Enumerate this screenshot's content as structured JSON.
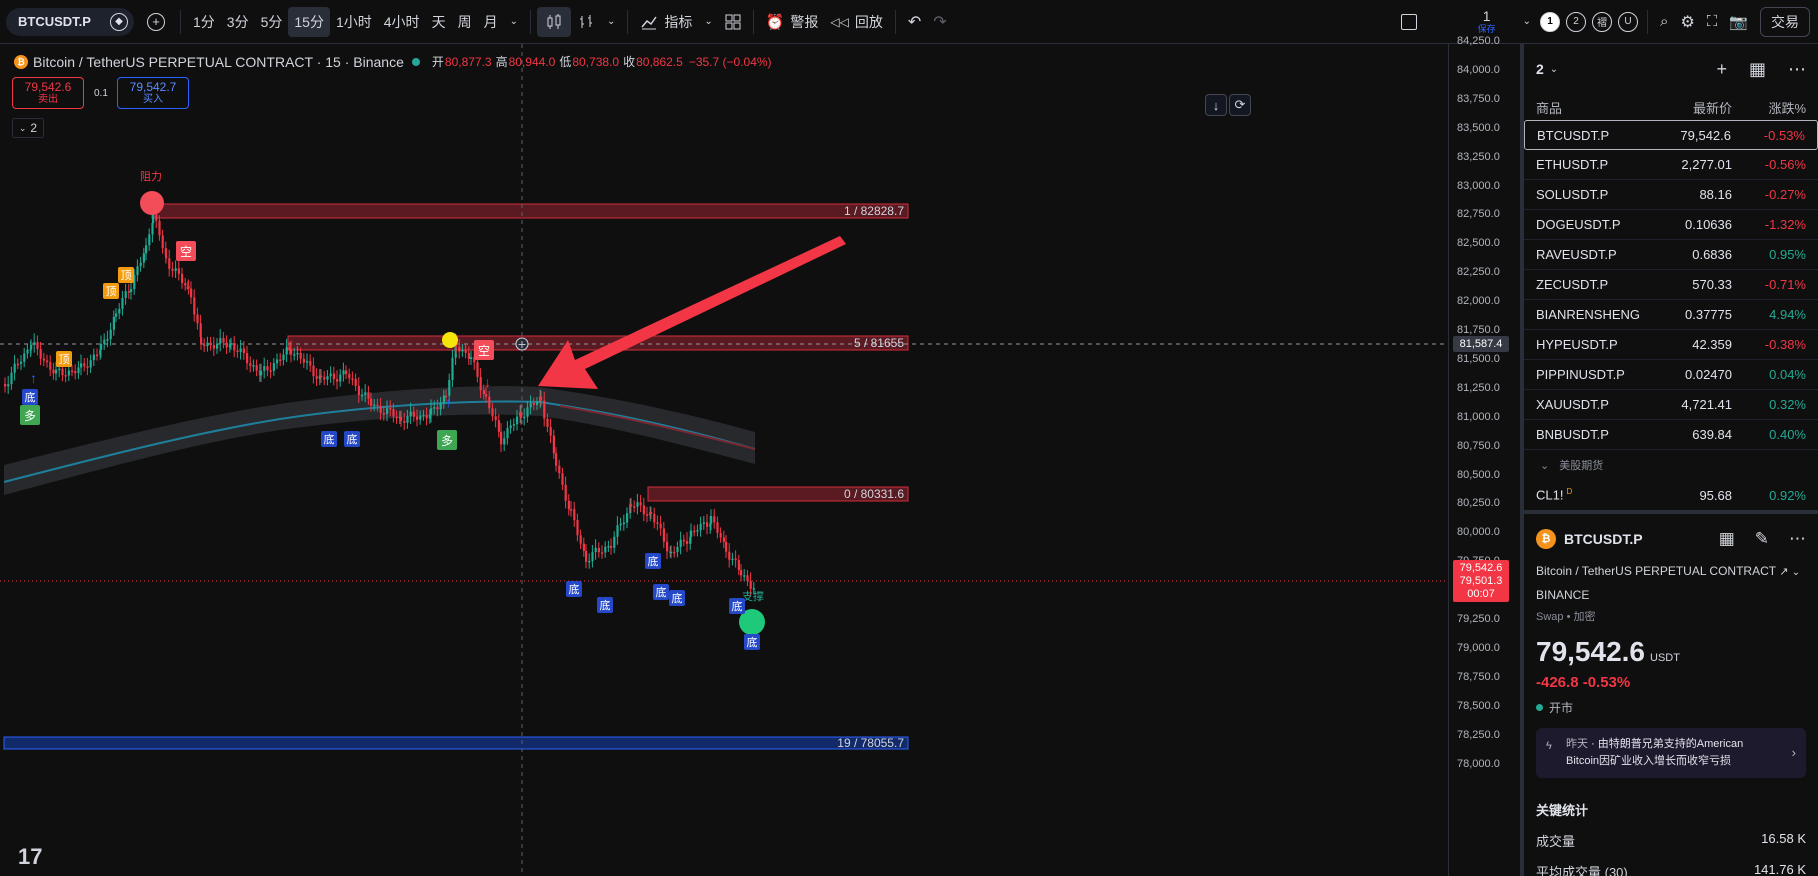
{
  "toolbar": {
    "symbol": "BTCUSDT.P",
    "timeframes": [
      "1分",
      "3分",
      "5分",
      "15分",
      "1小时",
      "4小时",
      "天",
      "周",
      "月"
    ],
    "active_timeframe": "15分",
    "indicators_label": "指标",
    "alert_label": "警报",
    "replay_label": "回放",
    "save_count": "1",
    "save_label": "保存",
    "layout_buttons": [
      "1",
      "2",
      "褶",
      "U"
    ],
    "trade_label": "交易"
  },
  "legend": {
    "title": "Bitcoin / TetherUS PERPETUAL CONTRACT · 15 · Binance",
    "open_label": "开",
    "open": "80,877.3",
    "high_label": "高",
    "high": "80,944.0",
    "low_label": "低",
    "low": "80,738.0",
    "close_label": "收",
    "close": "80,862.5",
    "change": "−35.7 (−0.04%)"
  },
  "order": {
    "sell_price": "79,542.6",
    "sell_label": "卖出",
    "spread": "0.1",
    "buy_price": "79,542.7",
    "buy_label": "买入",
    "collapse_count": "2"
  },
  "price_scale": {
    "ticks": [
      "84,250.0",
      "84,000.0",
      "83,750.0",
      "83,500.0",
      "83,250.0",
      "83,000.0",
      "82,750.0",
      "82,500.0",
      "82,250.0",
      "82,000.0",
      "81,750.0",
      "81,500.0",
      "81,250.0",
      "81,000.0",
      "80,750.0",
      "80,500.0",
      "80,250.0",
      "80,000.0",
      "79,750.0",
      "79,500.0",
      "79,250.0",
      "79,000.0",
      "78,750.0",
      "78,500.0",
      "78,250.0",
      "78,000.0"
    ],
    "crosshair_price": "81,587.4",
    "last_price": "79,542.6",
    "last_price2": "79,501.3",
    "countdown": "00:07"
  },
  "chart_annotations": {
    "resistance_label": "阻力",
    "levels": [
      "1 / 82828.7",
      "5 / 81655",
      "0 / 80331.6",
      "19 / 78055.7"
    ],
    "support_label": "支撑",
    "top": "顶",
    "bottom": "底",
    "long": "多",
    "short": "空"
  },
  "watchlist": {
    "id": "2",
    "columns": [
      "商品",
      "最新价",
      "涨跌%"
    ],
    "rows": [
      {
        "symbol": "BTCUSDT.P",
        "price": "79,542.6",
        "change": "-0.53%",
        "dir": "dn"
      },
      {
        "symbol": "ETHUSDT.P",
        "price": "2,277.01",
        "change": "-0.56%",
        "dir": "dn"
      },
      {
        "symbol": "SOLUSDT.P",
        "price": "88.16",
        "change": "-0.27%",
        "dir": "dn"
      },
      {
        "symbol": "DOGEUSDT.P",
        "price": "0.10636",
        "change": "-1.32%",
        "dir": "dn"
      },
      {
        "symbol": "RAVEUSDT.P",
        "price": "0.6836",
        "change": "0.95%",
        "dir": "up"
      },
      {
        "symbol": "ZECUSDT.P",
        "price": "570.33",
        "change": "-0.71%",
        "dir": "dn"
      },
      {
        "symbol": "BIANRENSHENG",
        "price": "0.37775",
        "change": "4.94%",
        "dir": "up"
      },
      {
        "symbol": "HYPEUSDT.P",
        "price": "42.359",
        "change": "-0.38%",
        "dir": "dn"
      },
      {
        "symbol": "PIPPINUSDT.P",
        "price": "0.02470",
        "change": "0.04%",
        "dir": "up"
      },
      {
        "symbol": "XAUUSDT.P",
        "price": "4,721.41",
        "change": "0.32%",
        "dir": "up"
      },
      {
        "symbol": "BNBUSDT.P",
        "price": "639.84",
        "change": "0.40%",
        "dir": "up"
      }
    ],
    "section_label": "美股期货",
    "extra_row": {
      "symbol": "CL1!",
      "price": "95.68",
      "change": "0.92%",
      "dir": "up"
    }
  },
  "detail": {
    "symbol": "BTCUSDT.P",
    "name": "Bitcoin / TetherUS PERPETUAL CONTRACT",
    "exchange": "BINANCE",
    "meta": "Swap • 加密",
    "price": "79,542.6",
    "currency": "USDT",
    "change": "-426.8  -0.53%",
    "status": "开市",
    "news_day": "昨天",
    "news_text": "由特朗普兄弟支持的American Bitcoin因矿业收入增长而收窄亏损",
    "key_stats_title": "关键统计",
    "stats": [
      {
        "label": "成交量",
        "value": "16.58 K"
      },
      {
        "label": "平均成交量 (30)",
        "value": "141.76 K"
      }
    ]
  },
  "colors": {
    "up": "#22ab94",
    "down": "#f23645",
    "accent": "#2962ff",
    "background": "#0f0f0f"
  }
}
